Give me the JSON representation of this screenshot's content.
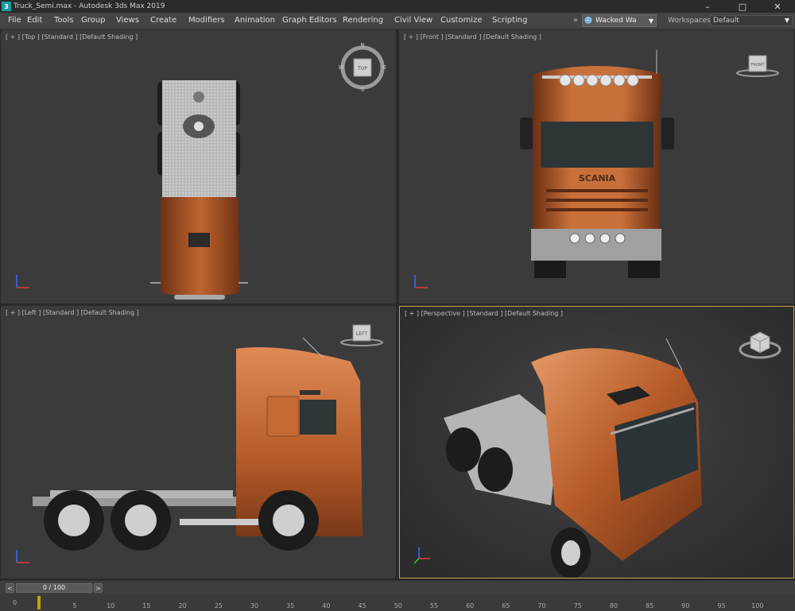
{
  "window": {
    "title": "Truck_Semi.max - Autodesk 3ds Max 2019",
    "icon": "3ds-max-app-icon",
    "controls": [
      "–",
      "□",
      "✕"
    ]
  },
  "menu": {
    "items": [
      "File",
      "Edit",
      "Tools",
      "Group",
      "Views",
      "Create",
      "Modifiers",
      "Animation",
      "Graph Editors",
      "Rendering",
      "Civil View",
      "Customize",
      "Scripting"
    ],
    "more": "»",
    "user": "Wacked Wa",
    "workspaces_label": "Workspaces:",
    "workspace": "Default"
  },
  "viewports": {
    "top": {
      "label": "[ + ] [Top ] [Standard ] [Default Shading ]",
      "cube_label": "TOP",
      "compass": [
        "N",
        "E",
        "S",
        "W"
      ]
    },
    "front": {
      "label": "[ + ] [Front ] [Standard ] [Default Shading ]",
      "cube_label": "FRONT",
      "grille_text": "SCANIA"
    },
    "left": {
      "label": "[ + ] [Left ] [Standard ] [Default Shading ]",
      "cube_label": "LEFT"
    },
    "perspective": {
      "label": "[ + ] [Perspective ] [Standard ] [Default Shading ]"
    }
  },
  "colors": {
    "truck_body": "#b55a28",
    "truck_highlight": "#e08a55",
    "active_viewport_border": "#c9a44a",
    "scrubber": "#c9a400"
  },
  "timeline": {
    "frame_display": "0 / 100",
    "prev": "<",
    "next": ">",
    "start_marker": "0",
    "ticks": [
      "5",
      "10",
      "15",
      "20",
      "25",
      "30",
      "35",
      "40",
      "45",
      "50",
      "55",
      "60",
      "65",
      "70",
      "75",
      "80",
      "85",
      "90",
      "95",
      "100"
    ]
  }
}
